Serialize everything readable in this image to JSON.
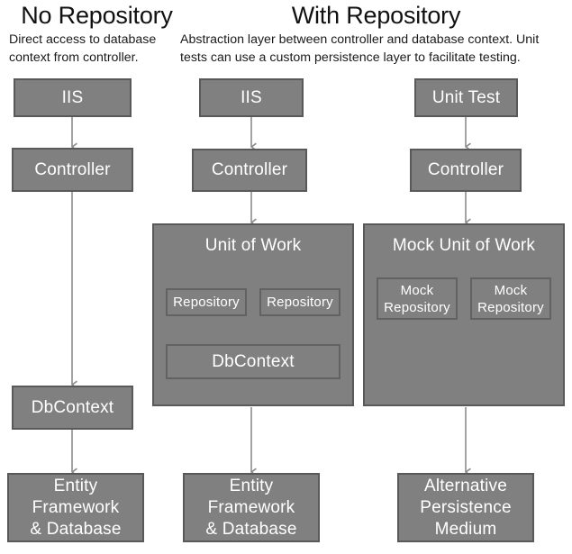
{
  "columns": [
    {
      "id": "no-repository",
      "heading": "No Repository",
      "subtitle": "Direct access to database context from controller."
    },
    {
      "id": "with-repository",
      "heading": "With Repository",
      "subtitle": "Abstraction layer between controller and database context. Unit tests can use a custom persistence layer to facilitate testing."
    }
  ],
  "left_column": {
    "iis": "IIS",
    "controller": "Controller",
    "dbcontext": "DbContext",
    "database": "Entity\nFramework\n& Database"
  },
  "middle_column": {
    "iis": "IIS",
    "controller": "Controller",
    "unit_of_work": "Unit of Work",
    "repository_1": "Repository",
    "repository_2": "Repository",
    "dbcontext": "DbContext",
    "database": "Entity\nFramework\n& Database"
  },
  "right_column": {
    "unit_test": "Unit Test",
    "controller": "Controller",
    "mock_unit_of_work": "Mock Unit of Work",
    "mock_repository_1": "Mock\nRepository",
    "mock_repository_2": "Mock\nRepository",
    "persistence": "Alternative\nPersistence\nMedium"
  },
  "colors": {
    "box_fill": "#808080",
    "box_border": "#595959",
    "inner_border": "#626262",
    "box_text": "#ffffff",
    "arrow": "#8c8c8c",
    "page_text": "#1a1a1a",
    "background": "#ffffff"
  }
}
